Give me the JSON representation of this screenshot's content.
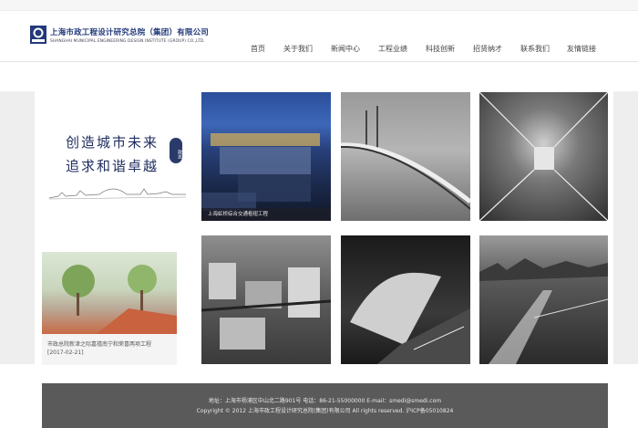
{
  "header": {
    "logo_cn": "上海市政工程设计研究总院（集团）有限公司",
    "logo_en": "SHANGHAI MUNICIPAL ENGINEERING DESIGN INSTITUTE (GROUP) CO.,LTD."
  },
  "nav": {
    "items": [
      "首页",
      "关于我们",
      "新闻中心",
      "工程业绩",
      "科技创新",
      "招贤纳才",
      "联系我们",
      "友情链接"
    ]
  },
  "slogan": {
    "line1": "创造城市未来",
    "line2": "追求和谐卓越",
    "seal": "政总"
  },
  "tiles": [
    {
      "caption": "上海虹桥综合交通枢纽工程"
    }
  ],
  "news": {
    "title": "市政总院新津之际嘉禧南宁和荣喜两项工程",
    "date": "[2017-02-21]"
  },
  "footer": {
    "line1": "地址：上海市杨浦区中山北二路901号  电话：86-21-55000000  E-mail：smedi@smedi.com",
    "line2": "Copyright © 2012 上海市政工程设计研究总院(集团)有限公司 All rights reserved.  沪ICP备05010824"
  },
  "colors": {
    "logo_blue": "#223a7a",
    "footer_bg": "#5a5a5a",
    "slogan_ink": "#1f2d5e"
  }
}
